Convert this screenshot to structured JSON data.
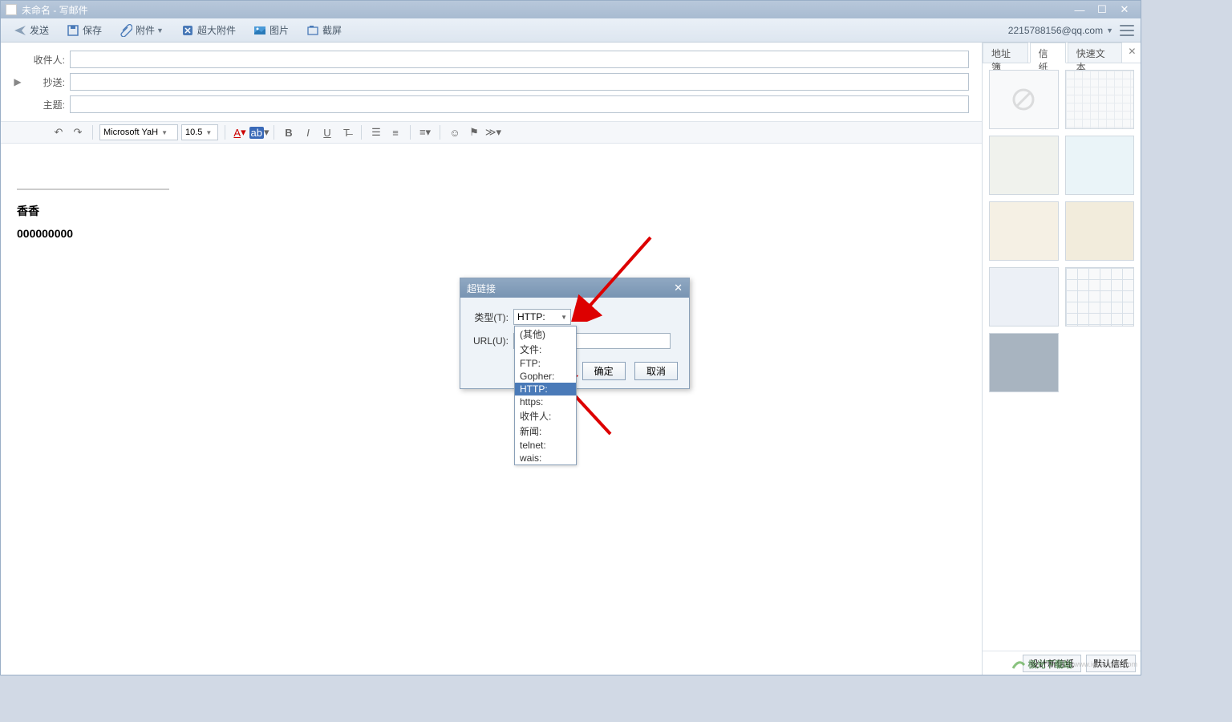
{
  "window": {
    "title": "未命名 - 写邮件"
  },
  "toolbar": {
    "send": "发送",
    "save": "保存",
    "attach": "附件",
    "bigattach": "超大附件",
    "image": "图片",
    "screenshot": "截屏"
  },
  "account": {
    "email": "2215788156@qq.com"
  },
  "fields": {
    "to": "收件人:",
    "cc": "抄送:",
    "subject": "主题:"
  },
  "format": {
    "font": "Microsoft YaH",
    "size": "10.5"
  },
  "editor": {
    "sig1": "香香",
    "sig2": "000000000"
  },
  "sidebar": {
    "tabs": [
      "地址簿",
      "信纸",
      "快速文本"
    ],
    "footer": [
      "设计新信纸",
      "默认信纸"
    ]
  },
  "dialog": {
    "title": "超链接",
    "type_label": "类型(T):",
    "type_value": "HTTP:",
    "url_label": "URL(U):",
    "url_value": "",
    "ok": "确定",
    "cancel": "取消",
    "options": [
      "(其他)",
      "文件:",
      "FTP:",
      "Gopher:",
      "HTTP:",
      "https:",
      "收件人:",
      "新闻:",
      "telnet:",
      "wais:"
    ],
    "selected_index": 4
  },
  "watermark": {
    "text1": "极光下载站",
    "text2": "www.iguangxia.com"
  }
}
